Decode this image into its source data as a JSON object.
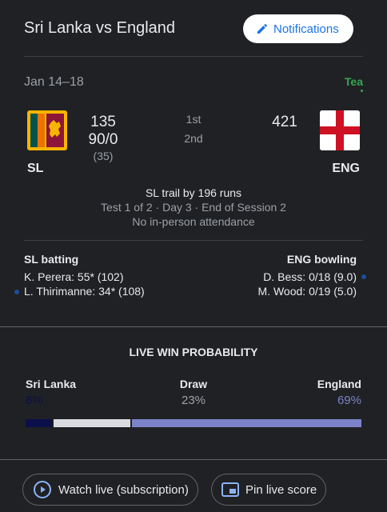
{
  "header": {
    "title": "Sri Lanka vs England",
    "notifications_label": "Notifications"
  },
  "match": {
    "dates": "Jan 14–18",
    "status": "Tea",
    "innings_labels": [
      "1st",
      "2nd"
    ],
    "summary": "SL trail by 196 runs",
    "info": "Test 1 of 2 · Day 3 · End of Session 2",
    "attendance": "No in-person attendance"
  },
  "teams": {
    "home": {
      "abbr": "SL",
      "scores": [
        "135",
        "90/0"
      ],
      "overs": "(35)",
      "flag_icon": "sri-lanka-flag-icon"
    },
    "away": {
      "abbr": "ENG",
      "scores": [
        "421"
      ],
      "flag_icon": "england-flag-icon"
    }
  },
  "batting": {
    "title": "SL batting",
    "players": [
      "K. Perera: 55* (102)",
      "L. Thirimanne: 34* (108)"
    ]
  },
  "bowling": {
    "title": "ENG bowling",
    "players": [
      "D. Bess: 0/18 (9.0)",
      "M. Wood: 0/19 (5.0)"
    ]
  },
  "win_probability": {
    "title": "LIVE WIN PROBABILITY",
    "outcomes": [
      {
        "label": "Sri Lanka",
        "percent_text": "8%",
        "value": 8,
        "color": "#0b0f4a"
      },
      {
        "label": "Draw",
        "percent_text": "23%",
        "value": 23,
        "color": "#dadce0"
      },
      {
        "label": "England",
        "percent_text": "69%",
        "value": 69,
        "color": "#7c83c9"
      }
    ]
  },
  "actions": {
    "watch_live": "Watch live (subscription)",
    "pin_score": "Pin live score"
  },
  "colors": {
    "background": "#202124",
    "accent": "#1a73e8",
    "status_green": "#34a853"
  }
}
